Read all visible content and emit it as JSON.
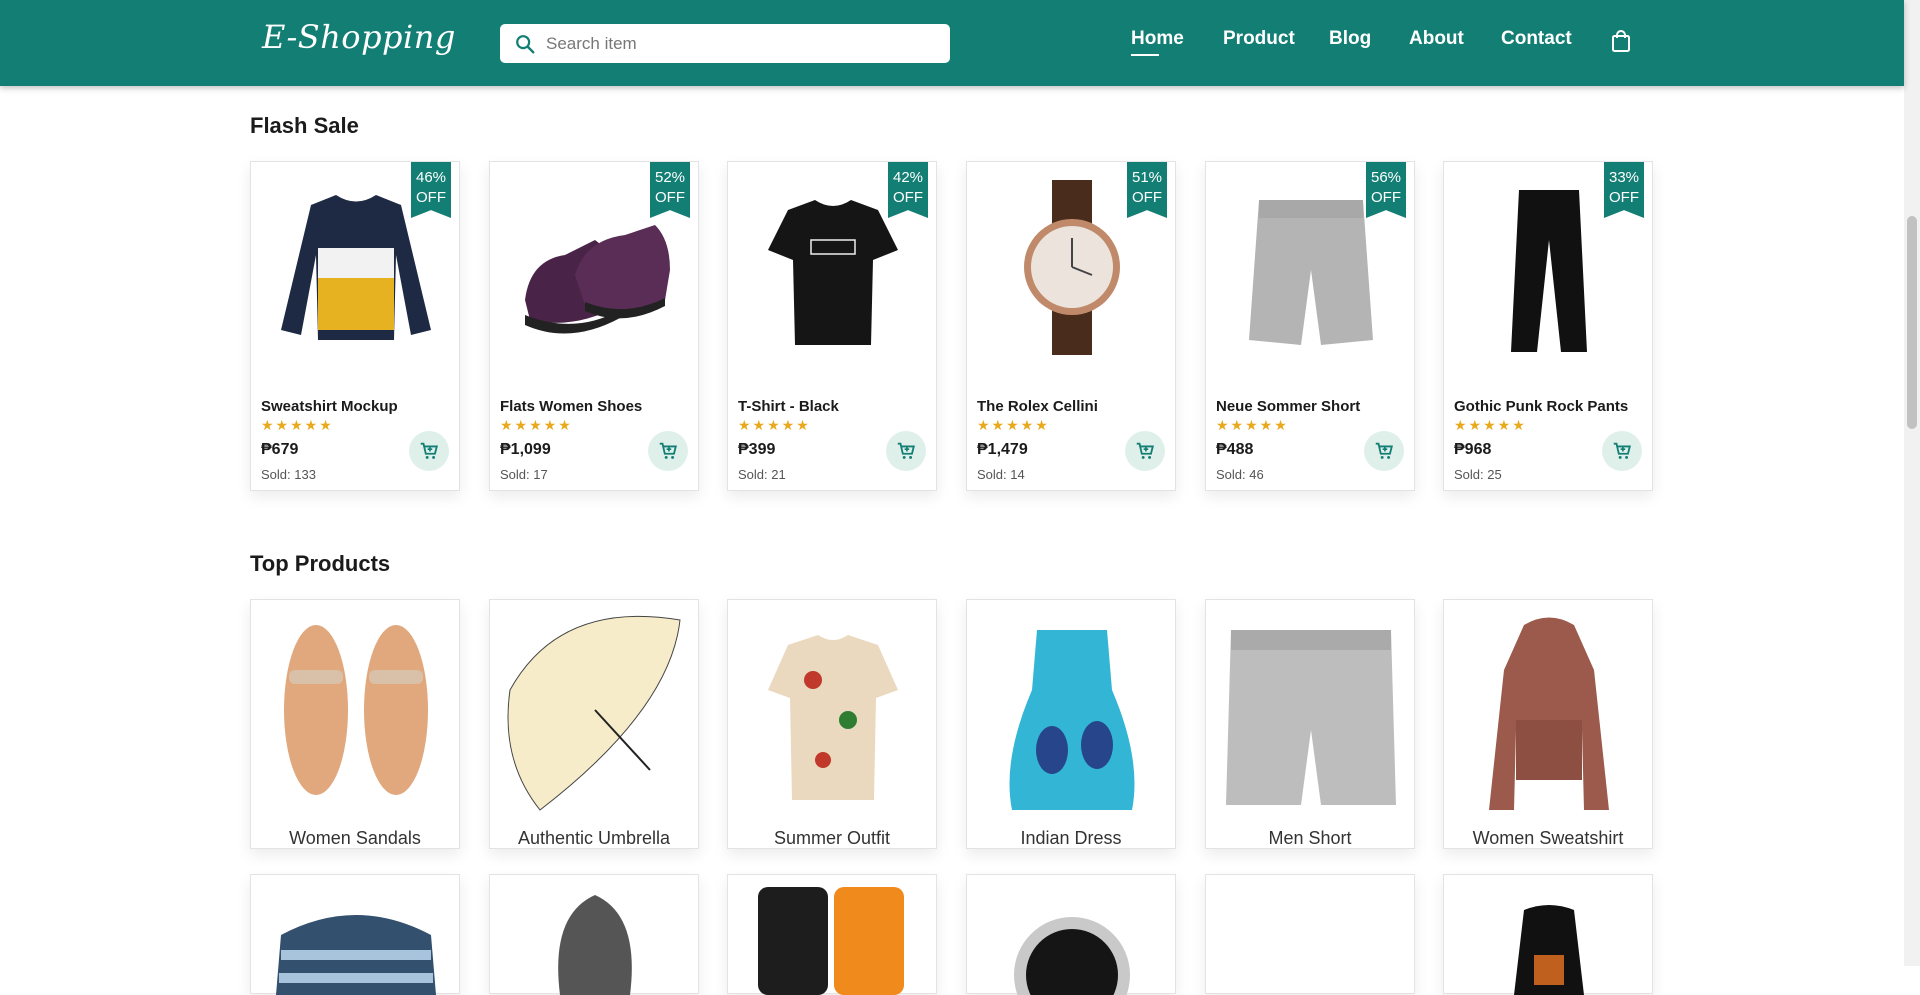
{
  "header": {
    "logo": "E-Shopping",
    "search_placeholder": "Search item",
    "nav": [
      "Home",
      "Product",
      "Blog",
      "About",
      "Contact"
    ],
    "active_nav": "Home"
  },
  "flash_sale": {
    "title": "Flash Sale",
    "items": [
      {
        "name": "Sweatshirt Mockup",
        "price": "₱679",
        "sold": "Sold: 133",
        "discount": "46%",
        "off": "OFF",
        "rating": 5
      },
      {
        "name": "Flats Women Shoes",
        "price": "₱1,099",
        "sold": "Sold: 17",
        "discount": "52%",
        "off": "OFF",
        "rating": 5
      },
      {
        "name": "T-Shirt - Black",
        "price": "₱399",
        "sold": "Sold: 21",
        "discount": "42%",
        "off": "OFF",
        "rating": 5
      },
      {
        "name": "The Rolex Cellini",
        "price": "₱1,479",
        "sold": "Sold: 14",
        "discount": "51%",
        "off": "OFF",
        "rating": 5
      },
      {
        "name": "Neue Sommer Short",
        "price": "₱488",
        "sold": "Sold: 46",
        "discount": "56%",
        "off": "OFF",
        "rating": 5
      },
      {
        "name": "Gothic Punk Rock Pants",
        "price": "₱968",
        "sold": "Sold: 25",
        "discount": "33%",
        "off": "OFF",
        "rating": 5
      }
    ]
  },
  "top_products": {
    "title": "Top Products",
    "items": [
      {
        "name": "Women Sandals"
      },
      {
        "name": "Authentic Umbrella"
      },
      {
        "name": "Summer Outfit"
      },
      {
        "name": "Indian Dress"
      },
      {
        "name": "Men Short"
      },
      {
        "name": "Women Sweatshirt"
      }
    ]
  },
  "colors": {
    "brand": "#127e74",
    "star": "#e8a91c",
    "cart_bg": "#dff0ea"
  },
  "icons": [
    "search-icon",
    "shopping-bag-icon",
    "cart-icon",
    "star-icon"
  ]
}
